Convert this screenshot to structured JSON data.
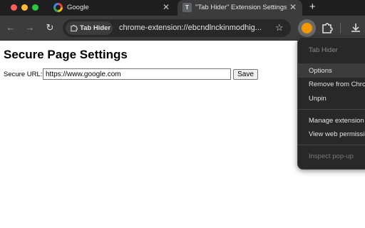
{
  "window": {
    "tabs": [
      {
        "title": "Google",
        "favicon": "google-g-icon",
        "close": "✕"
      },
      {
        "title": "\"Tab Hider\" Extension Settings",
        "favicon_letter": "T",
        "close": "✕"
      }
    ],
    "new_tab_label": "+"
  },
  "toolbar": {
    "back_icon": "←",
    "forward_icon": "→",
    "reload_icon": "↻",
    "chip_label": "Tab Hider",
    "url": "chrome-extension://ebcndlnckinmodhig...",
    "star_icon": "☆"
  },
  "page": {
    "title": "Secure Page Settings",
    "url_label": "Secure URL:",
    "url_value": "https://www.google.com",
    "save_label": "Save"
  },
  "menu": {
    "header": "Tab Hider",
    "items": [
      "Options",
      "Remove from Chrome...",
      "Unpin",
      "Manage extension",
      "View web permissions",
      "Inspect pop-up"
    ]
  },
  "colors": {
    "titlebar": "#1f1f1f",
    "toolbar": "#3c3c3c",
    "omnibox": "#282828",
    "menu_bg": "#282828",
    "extension_accent": "#f29900"
  }
}
